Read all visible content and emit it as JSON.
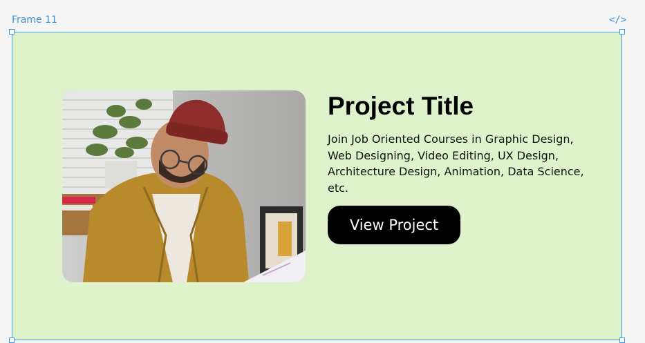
{
  "canvas": {
    "frame_label": "Frame 11",
    "code_icon_glyph": "</>",
    "accent_color": "#3d99e6",
    "frame_fill": "#def3cb"
  },
  "card": {
    "image_icon": "photo-person-writing",
    "title": "Project Title",
    "description": "Join Job Oriented Courses in Graphic Design, Web Designing, Video Editing, UX Design, Architecture Design, Animation, Data Science, etc.",
    "button_label": "View Project"
  }
}
